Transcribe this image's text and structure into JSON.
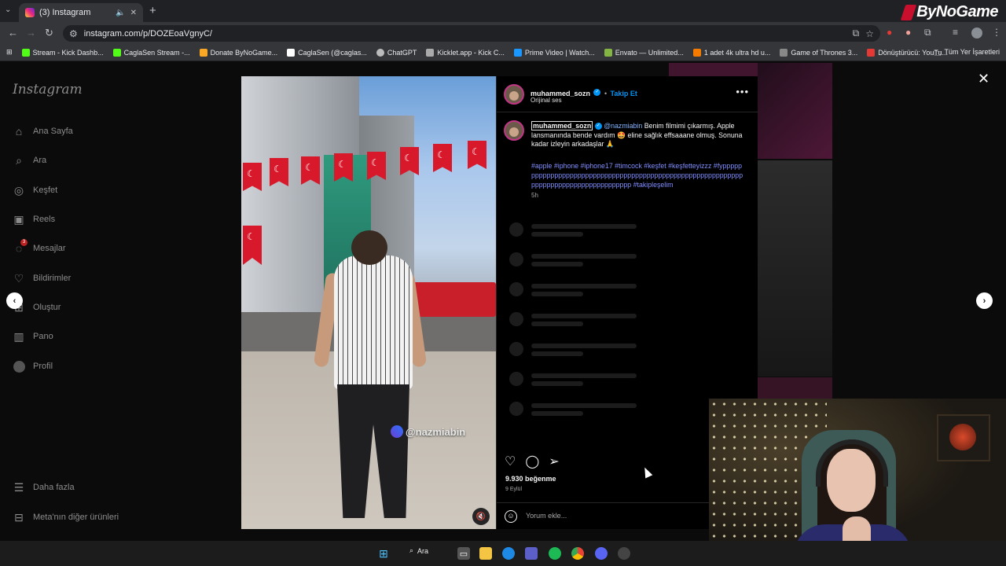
{
  "browser": {
    "tab_title": "(3) Instagram",
    "url": "instagram.com/p/DOZEoaVgnyC/",
    "brand": "ByNoGame",
    "bookmarks": [
      {
        "label": "Stream - Kick Dashb...",
        "color": "#53fc18"
      },
      {
        "label": "CaglaSen Stream -...",
        "color": "#53fc18"
      },
      {
        "label": "Donate ByNoGame...",
        "color": "#f9a825"
      },
      {
        "label": "CaglaSen (@caglas...",
        "color": "#ffffff"
      },
      {
        "label": "ChatGPT",
        "color": "#bbbbbb"
      },
      {
        "label": "Kicklet.app - Kick C...",
        "color": "#aaaaaa"
      },
      {
        "label": "Prime Video | Watch...",
        "color": "#1a98ff"
      },
      {
        "label": "Envato — Unlimited...",
        "color": "#82b541"
      },
      {
        "label": "1 adet 4k ultra hd u...",
        "color": "#f57c00"
      },
      {
        "label": "Game of Thrones 3...",
        "color": "#888888"
      },
      {
        "label": "Dönüştürücü: YouTu...",
        "color": "#e53935"
      }
    ],
    "all_bookmarks": "Tüm Yer İşaretleri"
  },
  "sidebar": {
    "logo": "Instagram",
    "items": [
      {
        "label": "Ana Sayfa",
        "icon": "home-icon",
        "glyph": "⌂"
      },
      {
        "label": "Ara",
        "icon": "search-icon",
        "glyph": "⌕"
      },
      {
        "label": "Keşfet",
        "icon": "compass-icon",
        "glyph": "◎"
      },
      {
        "label": "Reels",
        "icon": "reels-icon",
        "glyph": "▣"
      },
      {
        "label": "Mesajlar",
        "icon": "messenger-icon",
        "glyph": "◌"
      },
      {
        "label": "Bildirimler",
        "icon": "heart-icon",
        "glyph": "♡"
      },
      {
        "label": "Oluştur",
        "icon": "plus-square-icon",
        "glyph": "⊞"
      },
      {
        "label": "Pano",
        "icon": "dashboard-icon",
        "glyph": "▥"
      },
      {
        "label": "Profil",
        "icon": "profile-icon",
        "glyph": ""
      }
    ],
    "messages_badge": "3",
    "more": "Daha fazla",
    "meta": "Meta'nın diğer ürünleri"
  },
  "post": {
    "username": "muhammed_sozn",
    "follow": "Takip Et",
    "audio": "Orijinal ses",
    "caption_user": "muhammed_sozn",
    "caption_mention": "@nazmiabin",
    "caption_text": "Benim filmimi çıkarmış. Apple lansmanında bende vardım 🤩 eline sağlık effsaaane olmuş. Sonuna kadar izleyin arkadaşlar 🙏",
    "hashtags": "#apple #iphone #iphone17 #timcock #keşfet #keşfetteyizzz #fypppppppppppppppppppppppppppppppppppppppppppppppppppppppppppppppppppppppppppppppppppppp #takipleşelim",
    "time": "5h",
    "likes": "9.930 beğenme",
    "date": "9 Eylül",
    "comment_placeholder": "Yorum ekle...",
    "watermark": "@nazmiabin"
  },
  "taskbar": {
    "search": "Ara"
  }
}
